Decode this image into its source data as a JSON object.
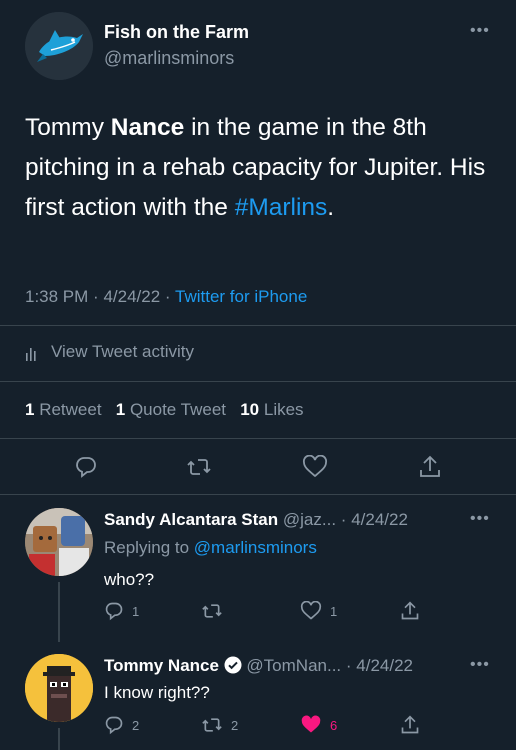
{
  "main_tweet": {
    "author_name": "Fish on the Farm",
    "author_handle": "@marlinsminors",
    "text_part1": "Tommy ",
    "text_bold": "Nance",
    "text_part2": " in the game in the 8th pitching in a rehab capacity for Jupiter. His first action with the ",
    "hashtag": "#Marlins",
    "text_end": ".",
    "time": "1:38 PM",
    "date": "4/24/22",
    "source": "Twitter for iPhone",
    "activity_label": "View Tweet activity",
    "retweets_count": "1",
    "retweets_label": "Retweet",
    "quotes_count": "1",
    "quotes_label": "Quote Tweet",
    "likes_count": "10",
    "likes_label": "Likes",
    "more_icon": "more-dots-icon"
  },
  "replies": [
    {
      "name": "Sandy Alcantara Stan",
      "handle": "@jaz...",
      "date": "4/24/22",
      "replying_prefix": "Replying to ",
      "replying_to": "@marlinsminors",
      "text": "who??",
      "reply_count": "1",
      "retweet_count": "",
      "like_count": "1",
      "liked": false
    },
    {
      "name": "Tommy Nance",
      "verified": true,
      "handle": "@TomNan...",
      "date": "4/24/22",
      "text": "I know right??",
      "reply_count": "2",
      "retweet_count": "2",
      "like_count": "6",
      "liked": true
    }
  ],
  "colors": {
    "background": "#15202b",
    "accent": "#1d9bf0",
    "muted": "#8b98a5",
    "like": "#f91880",
    "divider": "#38444d"
  }
}
